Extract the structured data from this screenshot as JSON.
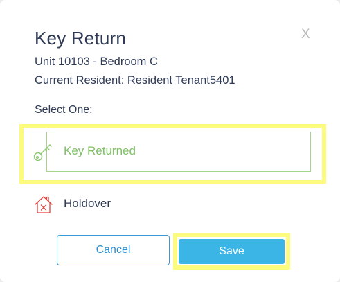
{
  "dialog": {
    "title": "Key Return",
    "close_label": "X",
    "unit": "Unit 10103 - Bedroom C",
    "resident": "Current Resident: Resident Tenant5401",
    "select_label": "Select One:"
  },
  "options": [
    {
      "label": "Key Returned",
      "icon": "key-icon",
      "selected": true,
      "color": "#7fc063"
    },
    {
      "label": "Holdover",
      "icon": "house-x-icon",
      "selected": false,
      "color": "#e0413c"
    }
  ],
  "buttons": {
    "cancel": "Cancel",
    "save": "Save"
  },
  "colors": {
    "text": "#2f3b56",
    "accent": "#3bb4e6",
    "highlight": "#fdfb7f",
    "selected_border": "#a7d58b"
  }
}
